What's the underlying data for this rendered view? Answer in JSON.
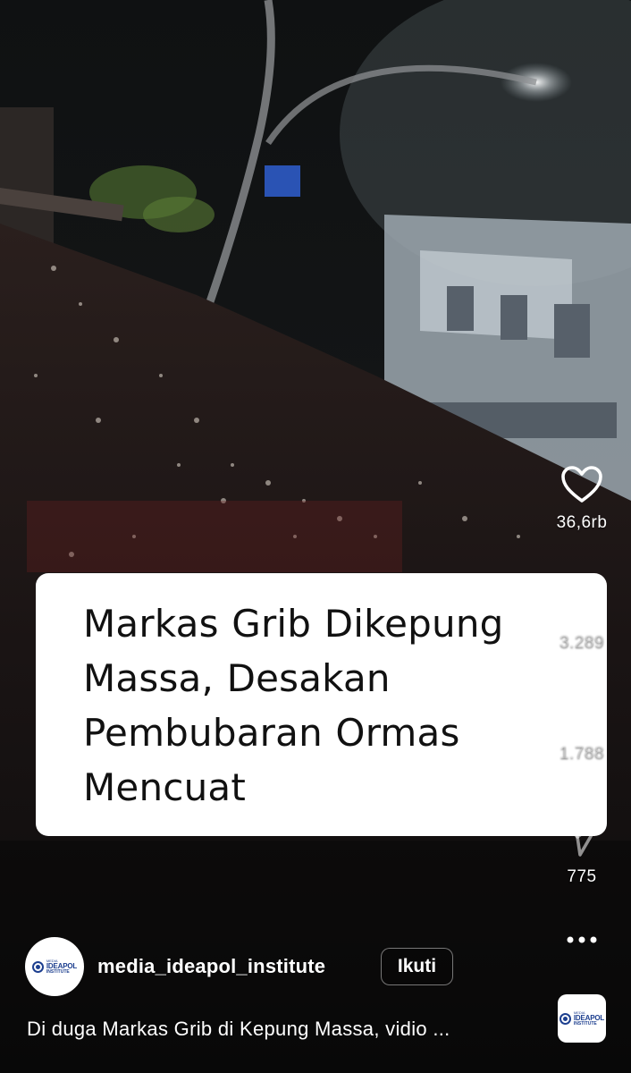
{
  "caption": {
    "lines": [
      "Markas Grib Dikepung",
      "Massa, Desakan",
      "Pembubaran Ormas",
      "Mencuat"
    ]
  },
  "actions": {
    "like": {
      "icon": "heart-icon",
      "count": "36,6rb"
    },
    "comment": {
      "icon": "comment-icon",
      "count": "3.289"
    },
    "repost": {
      "icon": "repost-icon",
      "count": "1.788"
    },
    "share": {
      "icon": "share-icon",
      "count": "775"
    },
    "more": {
      "icon": "more-icon"
    }
  },
  "author": {
    "username": "media_ideapol_institute",
    "follow_label": "Ikuti",
    "logo": {
      "top": "MEDIA",
      "name": "IDEAPOL",
      "sub": "INSTITUTE"
    }
  },
  "post": {
    "description": "Di duga Markas Grib di Kepung Massa, vidio ..."
  },
  "colors": {
    "background": "#000000",
    "caption_card": "#ffffff",
    "caption_text": "#111111",
    "logo_blue": "#1d3f8f"
  }
}
